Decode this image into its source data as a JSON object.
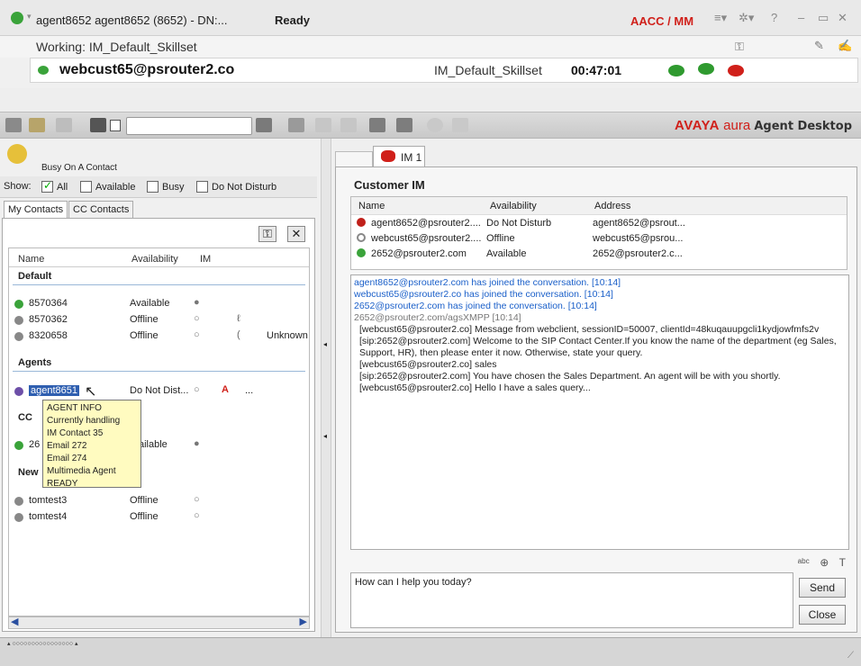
{
  "titlebar": {
    "title": "agent8652 agent8652 (8652) - DN:...",
    "state": "Ready",
    "mode": "AACC / MM"
  },
  "working": {
    "label": "Working: IM_Default_Skillset"
  },
  "active_contact": {
    "address": "webcust65@psrouter2.co",
    "skillset": "IM_Default_Skillset",
    "timer": "00:47:01"
  },
  "brand": {
    "avaya": "AVAYA",
    "aura": "aura",
    "product": "Agent Desktop"
  },
  "left": {
    "status": "Busy On A Contact",
    "filter": {
      "show": "Show:",
      "all": "All",
      "available": "Available",
      "busy": "Busy",
      "dnd": "Do Not Disturb"
    },
    "tabs": [
      "My Contacts",
      "CC Contacts"
    ],
    "columns": {
      "name": "Name",
      "availability": "Availability",
      "im": "IM"
    },
    "groups": {
      "default": "Default",
      "agents": "Agents",
      "cc": "CC",
      "new": "New"
    },
    "contacts": [
      {
        "name": "8570364",
        "availability": "Available",
        "extra": ""
      },
      {
        "name": "8570362",
        "availability": "Offline",
        "extra": ""
      },
      {
        "name": "8320658",
        "availability": "Offline",
        "extra": "Unknown"
      }
    ],
    "agent": {
      "name": "agent8651",
      "availability": "Do Not Dist...",
      "extra": "..."
    },
    "cc_contact": {
      "name": "26",
      "availability": "ailable"
    },
    "new_contacts": [
      {
        "name": "tomtest3",
        "availability": "Offline"
      },
      {
        "name": "tomtest4",
        "availability": "Offline"
      }
    ],
    "tooltip": [
      "AGENT INFO",
      "Currently handling",
      "IM Contact 35",
      "Email 272",
      "Email 274",
      "Multimedia Agent",
      "READY"
    ]
  },
  "im": {
    "tab_label": "IM 1",
    "title": "Customer IM",
    "columns": {
      "name": "Name",
      "availability": "Availability",
      "address": "Address"
    },
    "participants": [
      {
        "name": "agent8652@psrouter2....",
        "availability": "Do Not Disturb",
        "address": "agent8652@psrout..."
      },
      {
        "name": "webcust65@psrouter2....",
        "availability": "Offline",
        "address": "webcust65@psrou..."
      },
      {
        "name": "2652@psrouter2.com",
        "availability": "Available",
        "address": "2652@psrouter2.c..."
      }
    ],
    "log": [
      {
        "kind": "sys",
        "text": "agent8652@psrouter2.com has joined the conversation. [10:14]"
      },
      {
        "kind": "sys",
        "text": "webcust65@psrouter2.co has joined the conversation. [10:14]"
      },
      {
        "kind": "sys",
        "text": "2652@psrouter2.com has joined the conversation. [10:14]"
      },
      {
        "kind": "sys2",
        "text": "2652@psrouter2.com/agsXMPP [10:14]"
      },
      {
        "kind": "msg",
        "text": "[webcust65@psrouter2.co] Message from webclient, sessionID=50007, clientId=48kuqauupgcli1kydjowfmfs2v"
      },
      {
        "kind": "msg",
        "text": "[sip:2652@psrouter2.com] Welcome to the SIP Contact Center.If you know the name of the department (eg Sales, Support, HR), then please enter it now. Otherwise, state your query."
      },
      {
        "kind": "msg",
        "text": "[webcust65@psrouter2.co] sales"
      },
      {
        "kind": "msg",
        "text": "[sip:2652@psrouter2.com] You have chosen the Sales Department. An agent will be with you shortly."
      },
      {
        "kind": "msg",
        "text": "[webcust65@psrouter2.co] Hello I have a sales query..."
      }
    ],
    "input": "How can I help you today?",
    "send": "Send",
    "close": "Close"
  },
  "colors": {
    "accent_red": "#d0201a",
    "link_blue": "#1a5fc9",
    "available": "#3aa33a"
  }
}
